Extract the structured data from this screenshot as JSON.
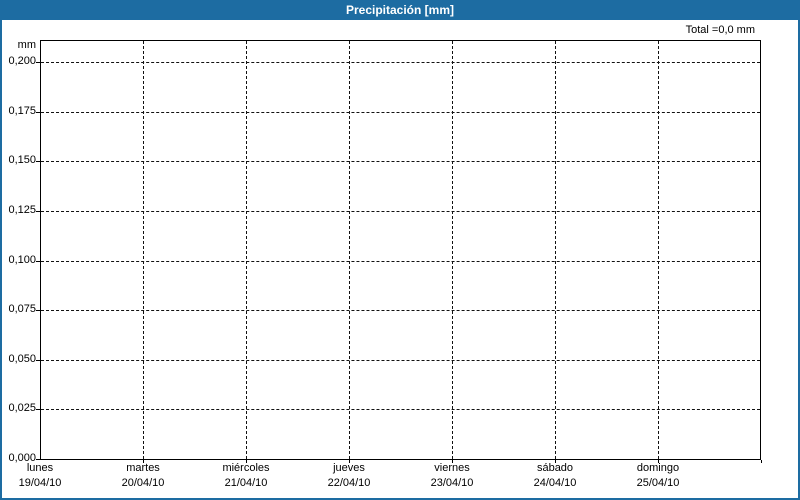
{
  "window": {
    "title": "Precipitación [mm]",
    "total_label": "Total =0,0 mm",
    "unit_label": "mm",
    "accent_color": "#1d6ca2",
    "text_color": "#000000",
    "titlebar_text_color": "#ffffff"
  },
  "chart_data": {
    "type": "bar",
    "title": "Precipitación [mm]",
    "ylabel": "mm",
    "ylim": [
      0,
      0.2125
    ],
    "grid": "dashed",
    "legend": "none",
    "total_annotation": "Total =0,0 mm",
    "y_ticks": [
      {
        "label": "0,200",
        "value": 0.2
      },
      {
        "label": "0,175",
        "value": 0.175
      },
      {
        "label": "0,150",
        "value": 0.15
      },
      {
        "label": "0,125",
        "value": 0.125
      },
      {
        "label": "0,100",
        "value": 0.1
      },
      {
        "label": "0,075",
        "value": 0.075
      },
      {
        "label": "0,050",
        "value": 0.05
      },
      {
        "label": "0,025",
        "value": 0.025
      },
      {
        "label": "0,000",
        "value": 0.0
      }
    ],
    "categories": [
      {
        "day": "lunes",
        "date": "19/04/10"
      },
      {
        "day": "martes",
        "date": "20/04/10"
      },
      {
        "day": "miércoles",
        "date": "21/04/10"
      },
      {
        "day": "jueves",
        "date": "22/04/10"
      },
      {
        "day": "viernes",
        "date": "23/04/10"
      },
      {
        "day": "sábado",
        "date": "24/04/10"
      },
      {
        "day": "domingo",
        "date": "25/04/10"
      }
    ],
    "series": [
      {
        "name": "Precipitación",
        "values": [
          0,
          0,
          0,
          0,
          0,
          0,
          0
        ]
      }
    ]
  }
}
